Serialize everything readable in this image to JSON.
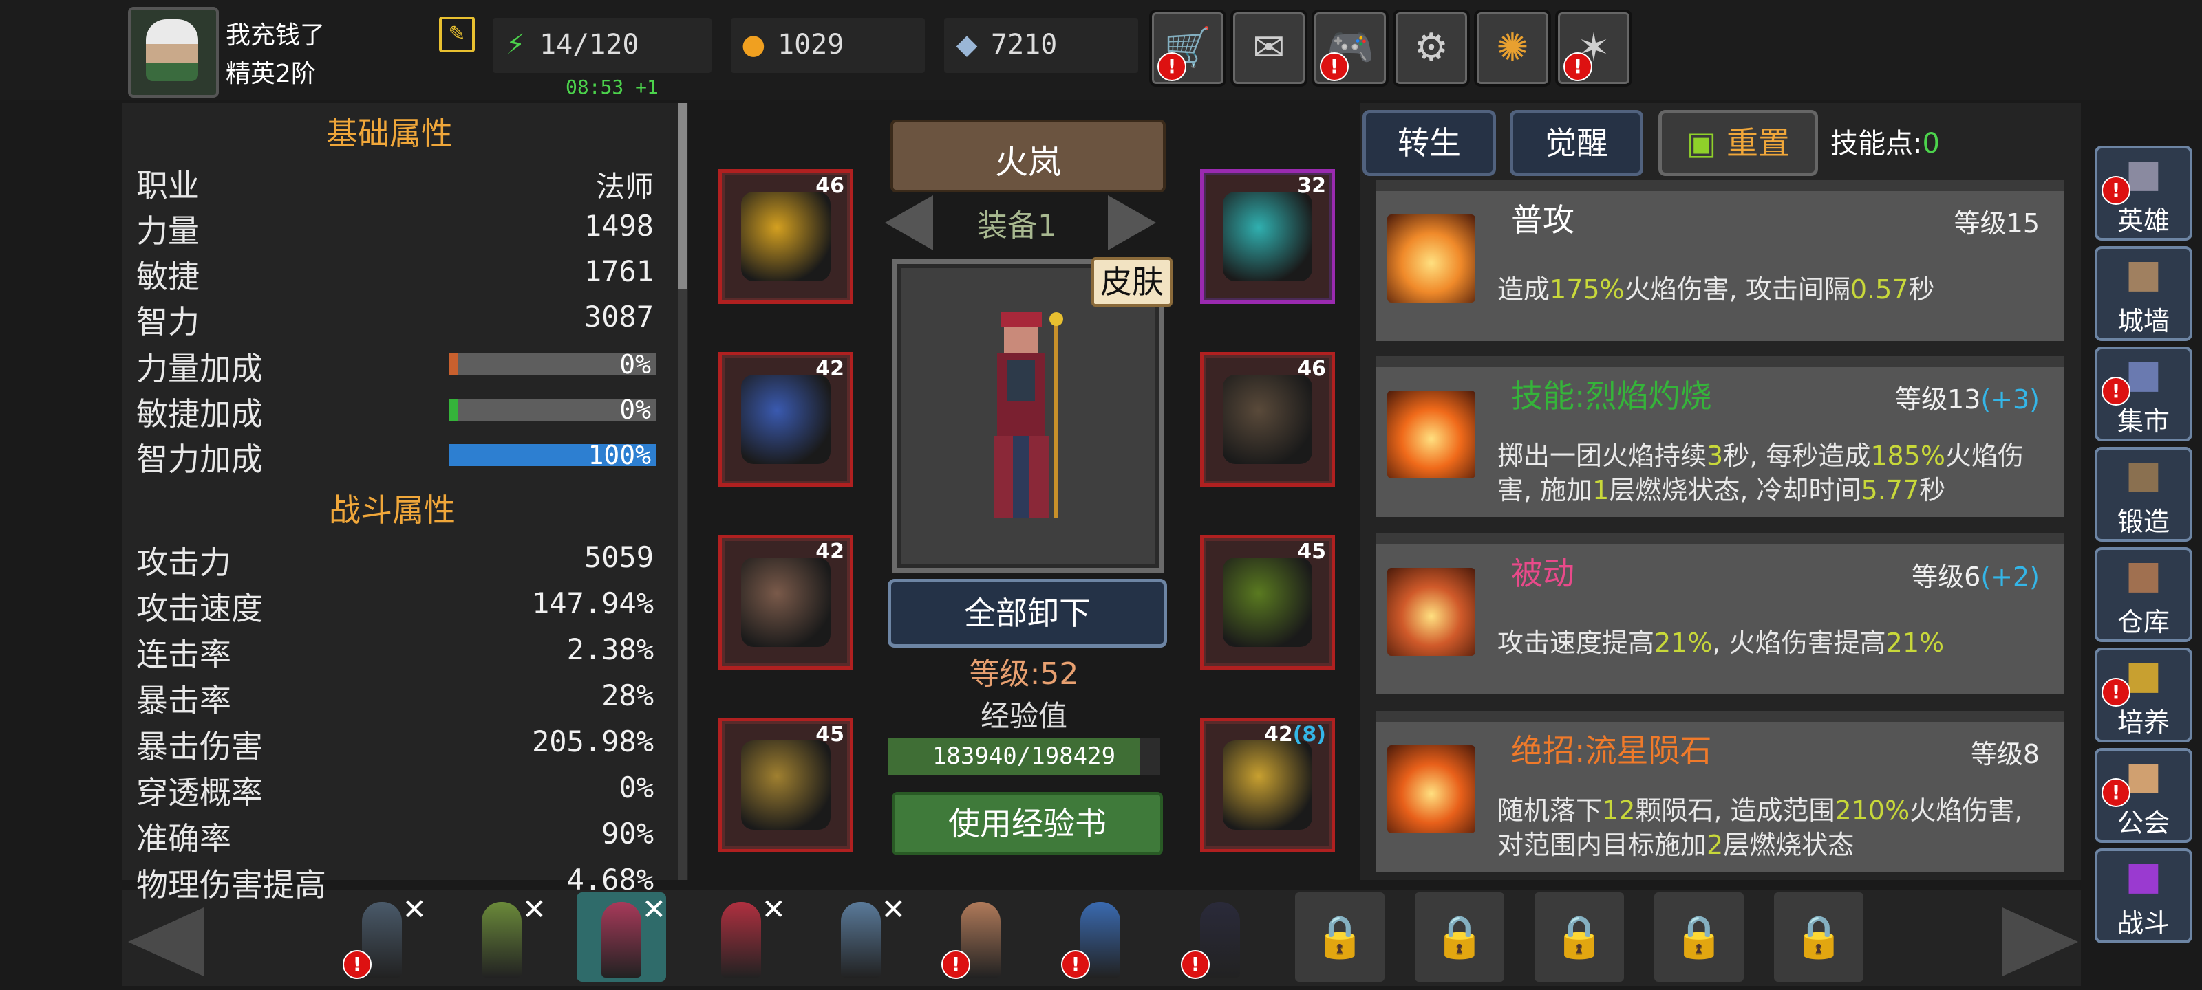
{
  "player": {
    "name": "我充钱了",
    "rank": "精英2阶"
  },
  "resources": {
    "energy": "14/120",
    "gold": "1029",
    "gems": "7210",
    "timer": "08:53 +1"
  },
  "top_buttons": [
    "cart-icon",
    "mail-icon",
    "gamepad-icon",
    "settings-icon",
    "camera-aperture-icon",
    "fireworks-icon"
  ],
  "basic_attributes": {
    "title": "基础属性",
    "rows": [
      {
        "label": "职业",
        "value": "法师"
      },
      {
        "label": "力量",
        "value": "1498"
      },
      {
        "label": "敏捷",
        "value": "1761"
      },
      {
        "label": "智力",
        "value": "3087"
      }
    ],
    "bonuses": [
      {
        "label": "力量加成",
        "value": "0%",
        "fill": 0.0,
        "color": "#c8602e"
      },
      {
        "label": "敏捷加成",
        "value": "0%",
        "fill": 0.0,
        "color": "#35b43a"
      },
      {
        "label": "智力加成",
        "value": "100%",
        "fill": 1.0,
        "color": "#2d7fd1"
      }
    ]
  },
  "combat_attributes": {
    "title": "战斗属性",
    "rows": [
      {
        "label": "攻击力",
        "value": "5059"
      },
      {
        "label": "攻击速度",
        "value": "147.94%"
      },
      {
        "label": "连击率",
        "value": "2.38%"
      },
      {
        "label": "暴击率",
        "value": "28%"
      },
      {
        "label": "暴击伤害",
        "value": "205.98%"
      },
      {
        "label": "穿透概率",
        "value": "0%"
      },
      {
        "label": "准确率",
        "value": "90%"
      },
      {
        "label": "物理伤害提高",
        "value": "4.68%"
      }
    ]
  },
  "equipment": {
    "hero_name": "火岚",
    "set_label": "装备1",
    "skin_label": "皮肤",
    "unequip_label": "全部卸下",
    "level_label": "等级:52",
    "exp_label": "经验值",
    "exp_text": "183940/198429",
    "exp_fraction": 0.927,
    "use_book_label": "使用经验书",
    "slots": [
      {
        "level": "46",
        "name": "helmet"
      },
      {
        "level": "42",
        "name": "armor"
      },
      {
        "level": "42",
        "name": "leggings"
      },
      {
        "level": "45",
        "name": "boots"
      },
      {
        "level": "32",
        "name": "necklace"
      },
      {
        "level": "46",
        "name": "gloves"
      },
      {
        "level": "45",
        "name": "talisman"
      },
      {
        "level": "42",
        "level_extra": "(8)",
        "name": "staff"
      }
    ]
  },
  "skill_panel": {
    "rebirth": "转生",
    "awaken": "觉醒",
    "reset": "重置",
    "points_label": "技能点:",
    "points_value": "0",
    "skills": [
      {
        "name": "普攻",
        "name_color": "#ffffff",
        "level": "等级15",
        "plus": "",
        "desc": [
          "造成",
          "175%",
          "火焰伤害, 攻击间隔",
          "0.57",
          "秒"
        ]
      },
      {
        "name": "技能:烈焰灼烧",
        "name_color": "#35b43a",
        "level": "等级13",
        "plus": "(+3)",
        "desc": [
          "掷出一团火焰持续",
          "3",
          "秒, 每秒造成",
          "185%",
          "火焰伤害, 施加",
          "1",
          "层燃烧状态, 冷却时间",
          "5.77",
          "秒"
        ]
      },
      {
        "name": "被动",
        "name_color": "#e84a8a",
        "level": "等级6",
        "plus": "(+2)",
        "desc": [
          "攻击速度提高",
          "21%",
          ", 火焰伤害提高",
          "21%"
        ]
      },
      {
        "name": "绝招:流星陨石",
        "name_color": "#f07a2a",
        "level": "等级8",
        "plus": "",
        "desc": [
          "随机落下",
          "12",
          "颗陨石, 造成范围",
          "210%",
          "火焰伤害, 对范围内目标施加",
          "2",
          "层燃烧状态"
        ]
      }
    ]
  },
  "side_nav": [
    {
      "label": "英雄",
      "icon": "helmet-icon",
      "badge": "!"
    },
    {
      "label": "城墙",
      "icon": "wall-icon",
      "badge": ""
    },
    {
      "label": "集市",
      "icon": "shop-icon",
      "badge": "!"
    },
    {
      "label": "锻造",
      "icon": "anvil-icon",
      "badge": ""
    },
    {
      "label": "仓库",
      "icon": "chest-icon",
      "badge": ""
    },
    {
      "label": "培养",
      "icon": "trophy-icon",
      "badge": "!"
    },
    {
      "label": "公会",
      "icon": "guild-icon",
      "badge": "!"
    },
    {
      "label": "战斗",
      "icon": "portal-icon",
      "badge": ""
    }
  ],
  "hero_strip": {
    "heroes": [
      {
        "x": true,
        "badge": true,
        "color": "#4a5a6a",
        "selected": false
      },
      {
        "x": true,
        "badge": false,
        "color": "#6b8a3a",
        "selected": false
      },
      {
        "x": true,
        "badge": false,
        "color": "#a83a5a",
        "selected": true
      },
      {
        "x": true,
        "badge": false,
        "color": "#b03040",
        "selected": false
      },
      {
        "x": true,
        "badge": false,
        "color": "#5a7a9a",
        "selected": false
      },
      {
        "x": false,
        "badge": true,
        "color": "#b07a5a",
        "selected": false
      },
      {
        "x": false,
        "badge": true,
        "color": "#3a6ab0",
        "selected": false
      },
      {
        "x": false,
        "badge": true,
        "color": "#2a2a3a",
        "selected": false
      }
    ],
    "locked_count": 5
  },
  "badge_text": "!",
  "x_text": "✕",
  "lock_glyph": "🔒"
}
